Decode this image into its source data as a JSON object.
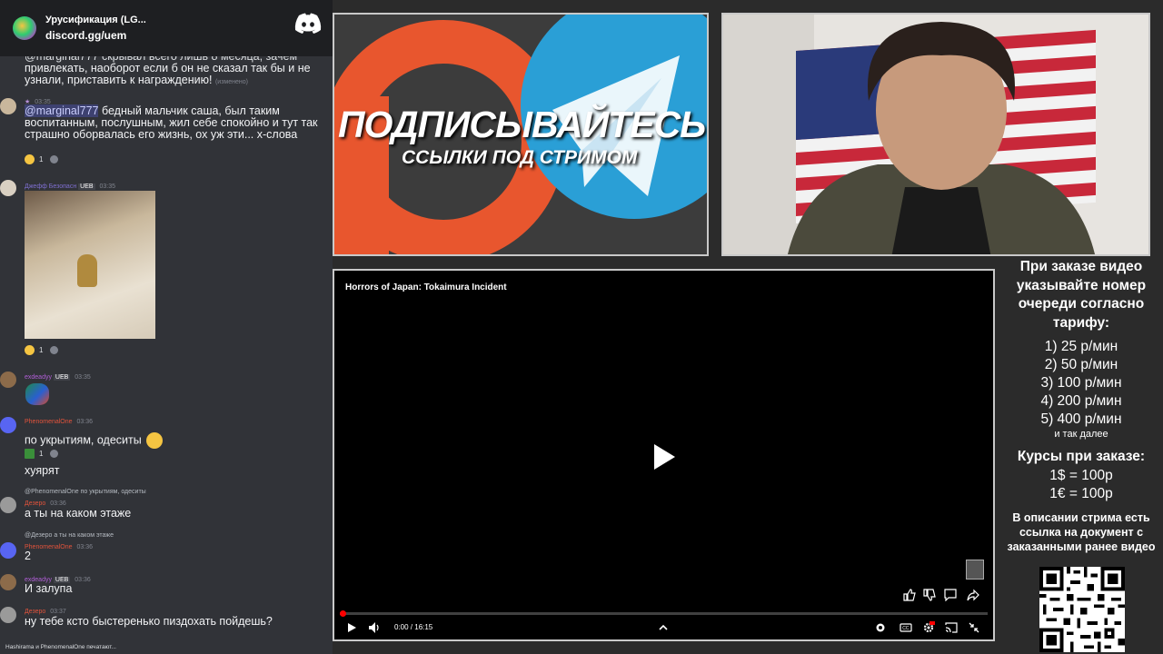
{
  "server": {
    "name": "Урусификация (LG...",
    "invite": "discord.gg/uem"
  },
  "messages": [
    {
      "top_text": "@marginal777 скрывал всего лишь 8 месяца, зачем",
      "text": "привлекать, наоборот если б он не сказал так бы и не узнали, приставить к награждению!",
      "edited": "(изменено)"
    },
    {
      "author": "",
      "time": "03:35",
      "mention": "@marginal777",
      "text": " бедный мальчик саша, был таким воспитанным, послушным, жил себе спокойно и тут так страшно оборвалась его жизнь, ох уж эти... х-слова",
      "reaction_count": "1"
    },
    {
      "author": "Джефф Безопасн",
      "badge": "UEB",
      "time": "03:35",
      "reaction_count": "1"
    },
    {
      "author": "exdeadyy",
      "badge": "UEB",
      "time": "03:35"
    },
    {
      "author": "PhenomenalOne",
      "time": "03:36",
      "text": "по укрытиям, одеситы",
      "reaction_count": "1",
      "text2": "хуярят"
    },
    {
      "reply": "@PhenomenalOne по укрытиям, одеситы",
      "author": "Дезеро",
      "time": "03:36",
      "text": "а ты на каком этаже"
    },
    {
      "reply": "@Дезеро а ты на каком этаже",
      "author": "PhenomenalOne",
      "time": "03:36",
      "text": "2"
    },
    {
      "author": "exdeadyy",
      "badge": "UEB",
      "time": "03:36",
      "text": "И залупа"
    },
    {
      "author": "Дезеро",
      "time": "03:37",
      "text": "ну тебе ксто быстеренько пиздохать пойдешь?"
    }
  ],
  "typing": "Hashirama и PhenomenalOne печатают...",
  "promo": {
    "title": "ПОДПИСЫВАЙТЕСЬ",
    "subtitle": "ССЫЛКИ ПОД СТРИМОМ"
  },
  "player": {
    "title": "Horrors of Japan: Tokaimura Incident",
    "time": "0:00 / 16:15",
    "progress_fraction": 0.003
  },
  "info": {
    "heading": "При заказе видео указывайте номер очереди согласно тарифу:",
    "tariffs": [
      "1) 25 р/мин",
      "2) 50 р/мин",
      "3) 100 р/мин",
      "4) 200 р/мин",
      "5) 400 р/мин"
    ],
    "etc": "и так далее",
    "rates_heading": "Курсы при заказе:",
    "rates": [
      "1$ = 100р",
      "1€ = 100р"
    ],
    "doc_note": "В описании стрима есть ссылка на документ с заказанными ранее видео"
  },
  "colors": {
    "discord_bg": "#313338",
    "blurple": "#5865f2",
    "telegram": "#2a9fd6",
    "patreon": "#e8562e"
  }
}
